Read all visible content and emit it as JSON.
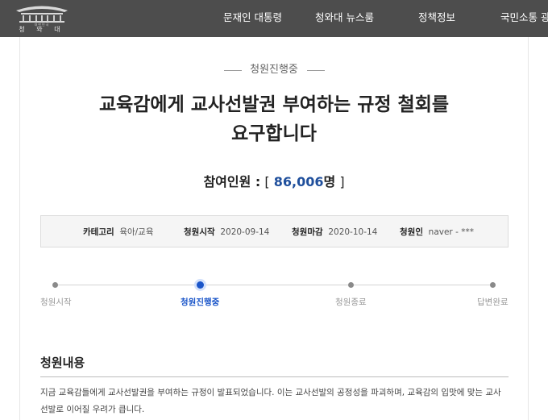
{
  "header": {
    "logo": {
      "emblem_text": "대한민국",
      "name": "청 와 대"
    },
    "nav": [
      "문재인 대통령",
      "청와대 뉴스룸",
      "정책정보",
      "국민소통 광"
    ]
  },
  "petition": {
    "status": "청원진행중",
    "title_line1": "교육감에게 교사선발권 부여하는 규정 철회를",
    "title_line2": "요구합니다",
    "participants": {
      "label": "참여인원 :",
      "open": "[",
      "number": "86,006",
      "unit": "명",
      "close": "]"
    },
    "info": {
      "category_label": "카테고리",
      "category_value": "육아/교육",
      "start_label": "청원시작",
      "start_value": "2020-09-14",
      "end_label": "청원마감",
      "end_value": "2020-10-14",
      "author_label": "청원인",
      "author_value": "naver - ***"
    },
    "progress": {
      "steps": [
        "청원시작",
        "청원진행중",
        "청원종료",
        "답변완료"
      ],
      "active_index": 1
    },
    "content": {
      "heading": "청원내용",
      "body": "지금 교육감들에게 교사선발권을 부여하는 규정이 발표되었습니다. 이는 교사선발의 공정성을 파괴하며, 교육감의 입맛에 맞는 교사선발로 이어질 우려가 큽니다."
    }
  },
  "colors": {
    "header_bg": "#4d4d4d",
    "accent": "#1f4f9c",
    "active_step": "#1b56c9"
  }
}
